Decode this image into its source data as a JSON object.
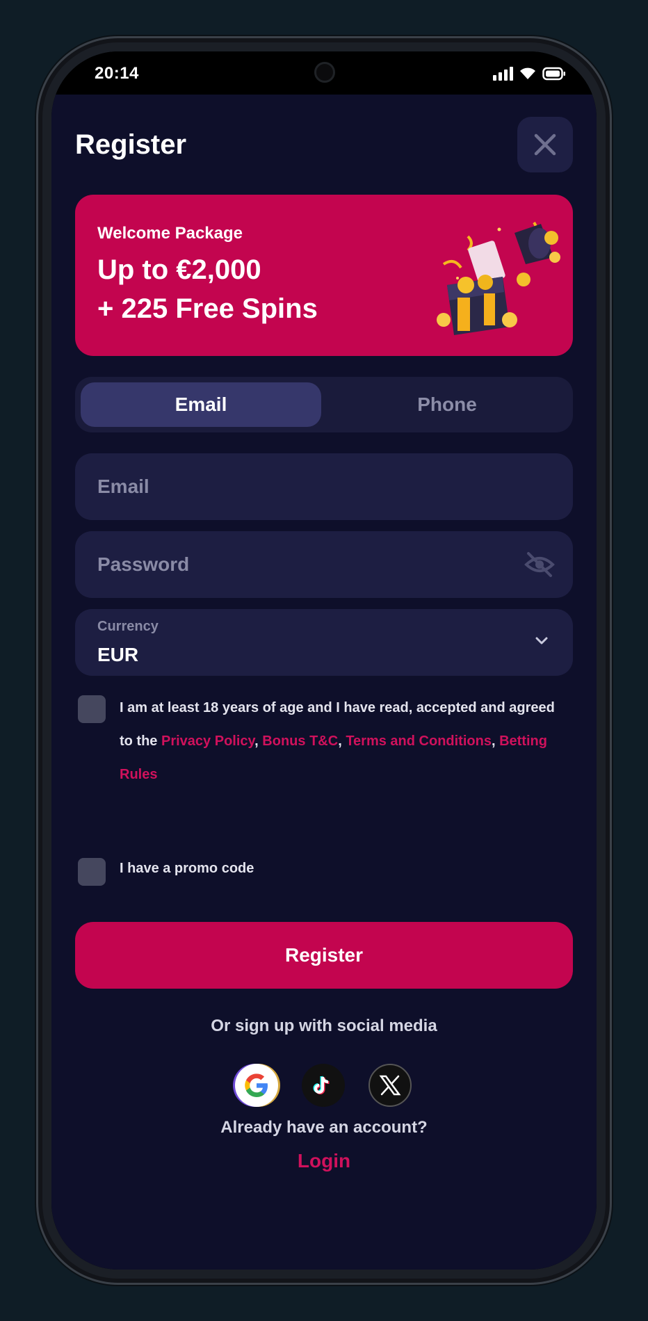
{
  "status_bar": {
    "time": "20:14"
  },
  "header": {
    "title": "Register"
  },
  "banner": {
    "subtitle": "Welcome Package",
    "line1": "Up to €2,000",
    "line2": "+ 225 Free Spins"
  },
  "tabs": [
    {
      "label": "Email",
      "active": true
    },
    {
      "label": "Phone",
      "active": false
    }
  ],
  "form": {
    "email_placeholder": "Email",
    "password_placeholder": "Password",
    "currency_label": "Currency",
    "currency_value": "EUR"
  },
  "terms": {
    "text1": "I am at least 18 years of age and I have read, accepted and agreed to the ",
    "privacy": "Privacy Policy",
    "sep1": ", ",
    "bonus": "Bonus T&C",
    "sep2": ", ",
    "tnc": "Terms and Conditions",
    "sep3": ", ",
    "betting": "Betting Rules"
  },
  "promo_label": "I have a promo code",
  "register_button": "Register",
  "social": {
    "caption": "Or sign up with social media",
    "providers": [
      "google-icon",
      "tiktok-icon",
      "x-icon"
    ]
  },
  "account": {
    "prompt": "Already have an account?",
    "login": "Login"
  },
  "colors": {
    "accent": "#c3054f",
    "background": "#0e0f2a",
    "field": "#1d1e42"
  }
}
